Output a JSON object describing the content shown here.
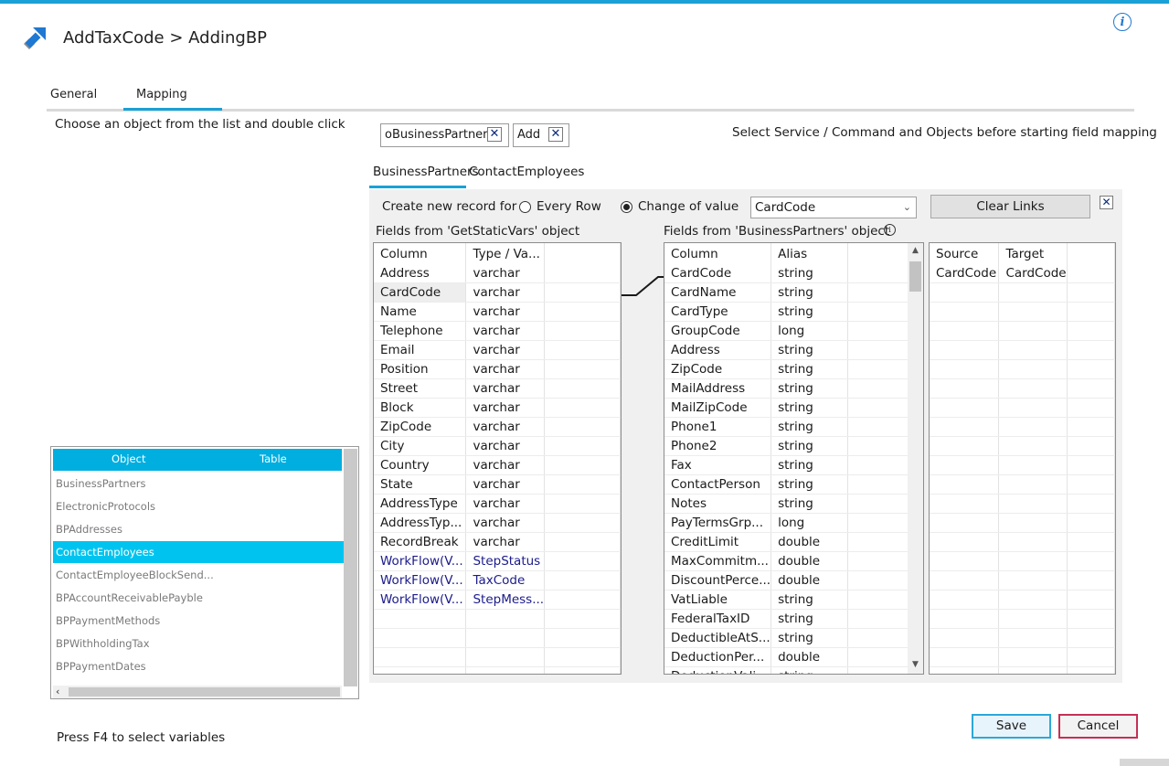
{
  "header": {
    "title": "AddTaxCode > AddingBP"
  },
  "tabs": [
    {
      "label": "General"
    },
    {
      "label": "Mapping"
    }
  ],
  "left": {
    "hint": "Choose an object from the list and double click",
    "footer": "Press F4 to select variables",
    "object_list": {
      "columns": [
        "Object",
        "Table"
      ],
      "items": [
        "BusinessPartners",
        "ElectronicProtocols",
        "BPAddresses",
        "ContactEmployees",
        "ContactEmployeeBlockSend...",
        "BPAccountReceivablePayble",
        "BPPaymentMethods",
        "BPWithholdingTax",
        "BPPaymentDates"
      ],
      "selected": "ContactEmployees"
    }
  },
  "chips": [
    {
      "label": "oBusinessPartners"
    },
    {
      "label": "Add"
    }
  ],
  "right_hint": "Select Service / Command and Objects before starting field mapping",
  "subtabs": [
    {
      "label": "BusinessPartners"
    },
    {
      "label": "ContactEmployees"
    }
  ],
  "mapping": {
    "create_label": "Create new record for",
    "radio_every_row": "Every Row",
    "radio_change": "Change of value",
    "selected_radio": "Change of value",
    "dropdown_value": "CardCode",
    "clear_links": "Clear Links",
    "source_title": "Fields from 'GetStaticVars' object",
    "target_title": "Fields from 'BusinessPartners' object",
    "source_headers": [
      "Column",
      "Type / Va..."
    ],
    "source_rows": [
      [
        "Address",
        "varchar"
      ],
      [
        "CardCode",
        "varchar"
      ],
      [
        "Name",
        "varchar"
      ],
      [
        "Telephone",
        "varchar"
      ],
      [
        "Email",
        "varchar"
      ],
      [
        "Position",
        "varchar"
      ],
      [
        "Street",
        "varchar"
      ],
      [
        "Block",
        "varchar"
      ],
      [
        "ZipCode",
        "varchar"
      ],
      [
        "City",
        "varchar"
      ],
      [
        "Country",
        "varchar"
      ],
      [
        "State",
        "varchar"
      ],
      [
        "AddressType",
        "varchar"
      ],
      [
        "AddressTyp...",
        "varchar"
      ],
      [
        "RecordBreak",
        "varchar"
      ],
      [
        "WorkFlow(V...",
        "StepStatus"
      ],
      [
        "WorkFlow(V...",
        "TaxCode"
      ],
      [
        "WorkFlow(V...",
        "StepMess..."
      ]
    ],
    "target_headers": [
      "Column",
      "Alias"
    ],
    "target_rows": [
      [
        "CardCode",
        "string"
      ],
      [
        "CardName",
        "string"
      ],
      [
        "CardType",
        "string"
      ],
      [
        "GroupCode",
        "long"
      ],
      [
        "Address",
        "string"
      ],
      [
        "ZipCode",
        "string"
      ],
      [
        "MailAddress",
        "string"
      ],
      [
        "MailZipCode",
        "string"
      ],
      [
        "Phone1",
        "string"
      ],
      [
        "Phone2",
        "string"
      ],
      [
        "Fax",
        "string"
      ],
      [
        "ContactPerson",
        "string"
      ],
      [
        "Notes",
        "string"
      ],
      [
        "PayTermsGrp...",
        "long"
      ],
      [
        "CreditLimit",
        "double"
      ],
      [
        "MaxCommitm...",
        "double"
      ],
      [
        "DiscountPerce...",
        "double"
      ],
      [
        "VatLiable",
        "string"
      ],
      [
        "FederalTaxID",
        "string"
      ],
      [
        "DeductibleAtS...",
        "string"
      ],
      [
        "DeductionPer...",
        "double"
      ],
      [
        "DeductionVali...",
        "string"
      ]
    ],
    "links_headers": [
      "Source",
      "Target"
    ],
    "links_rows": [
      [
        "CardCode",
        "CardCode"
      ]
    ]
  },
  "buttons": {
    "save": "Save",
    "cancel": "Cancel"
  },
  "colors": {
    "accent": "#1aa1d6",
    "list_header": "#00aee0",
    "list_selected": "#00c4ef",
    "cancel_border": "#c62f55",
    "workflow_text": "#1b1b8c"
  }
}
